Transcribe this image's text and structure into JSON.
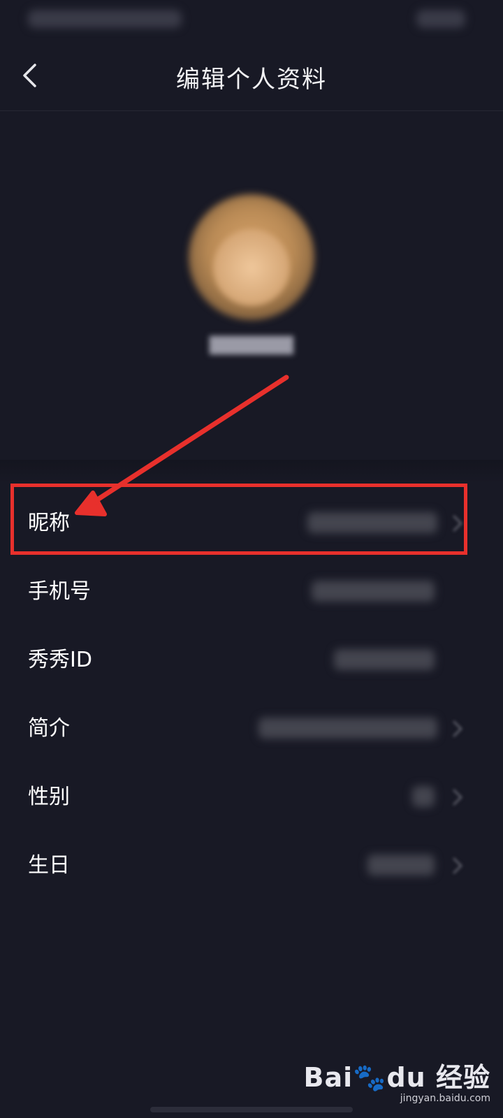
{
  "header": {
    "title": "编辑个人资料"
  },
  "profile_rows": [
    {
      "label": "昵称"
    },
    {
      "label": "手机号"
    },
    {
      "label": "秀秀ID"
    },
    {
      "label": "简介"
    },
    {
      "label": "性别"
    },
    {
      "label": "生日"
    }
  ],
  "watermark": {
    "brand": "Bai",
    "brand_tail": "du",
    "product": "经验",
    "url": "jingyan.baidu.com"
  },
  "colors": {
    "background": "#181925",
    "annotation_red": "#e8302c"
  },
  "icons": {
    "back": "chevron-left-icon",
    "row_arrow": "chevron-right-icon"
  }
}
